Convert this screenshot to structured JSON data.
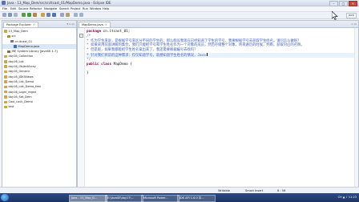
{
  "window": {
    "title": "Java - 13_Map_Dem/src/cn/itcast_01/MapDemo.java - Eclipse IDE",
    "min": "–",
    "max": "□",
    "close": "✕"
  },
  "menu": [
    "File",
    "Edit",
    "Source",
    "Refactor",
    "Navigate",
    "Search",
    "Project",
    "Run",
    "Window",
    "Help"
  ],
  "perspective": "Java",
  "package_explorer": {
    "tab_label": "Package Explorer",
    "tab_close": "✕",
    "items": [
      {
        "label": "13_Map_Dem",
        "icon": "project-icon",
        "indent": 0
      },
      {
        "label": "src",
        "icon": "source-folder-icon",
        "indent": 1
      },
      {
        "label": "cn.itcast_01",
        "icon": "package-icon",
        "indent": 2
      },
      {
        "label": "MapDemo.java",
        "icon": "java-file-icon",
        "indent": 3,
        "selected": true
      },
      {
        "label": "JRE System Library [JavaSE-1.7]",
        "icon": "library-icon",
        "indent": 1
      },
      {
        "label": "day16_Collection",
        "icon": "project-icon",
        "indent": 0
      },
      {
        "label": "day16_List",
        "icon": "project-icon",
        "indent": 0
      },
      {
        "label": "day16_ObjectArray",
        "icon": "project-icon",
        "indent": 0
      },
      {
        "label": "day16_Generic",
        "icon": "project-icon",
        "indent": 0
      },
      {
        "label": "day16_JDK5News",
        "icon": "project-icon",
        "indent": 0
      },
      {
        "label": "day16_List_Demo",
        "icon": "project-icon",
        "indent": 0
      },
      {
        "label": "day16_List_Demo_test",
        "icon": "project-icon",
        "indent": 0
      },
      {
        "label": "day16_Login_regist",
        "icon": "project-icon",
        "indent": 0
      },
      {
        "label": "day16_Set_Dem",
        "icon": "project-icon",
        "indent": 0
      },
      {
        "label": "Cool_Lock_Demo",
        "icon": "project-icon",
        "indent": 0
      },
      {
        "label": "test",
        "icon": "project-icon",
        "indent": 0
      }
    ]
  },
  "editor": {
    "tab_label": "MapDemo.java",
    "tab_close": "✕",
    "lines": [
      {
        "type": "code",
        "kw": "package",
        "rest": " cn.itcast_01;"
      },
      {
        "type": "comment",
        "text": "/*"
      },
      {
        "type": "comment",
        "text": " * 作为学生来说，是根据学号来区分不同的学生的，那么假设我现在已经知道了学生的学号，我要根据学号去获取学生姓名，请问怎么做呢？"
      },
      {
        "type": "comment",
        "text": " * 如果采用前面讲解的集合，我们只能把学号和学生姓名作为一个对象的成员，然后存储整个对象，将来遍历的时候，判断，获取对应的名称。"
      },
      {
        "type": "comment",
        "text": " * 但是呢，如果我都能把学生姓名拿出来了，我还需要根据编号去找吗？"
      },
      {
        "type": "comment",
        "text": " * 针对我们目前的这种需求：仅仅知道学号，就想知道学生姓名的情况，Java",
        "current": true
      },
      {
        "type": "comment",
        "text": " */"
      },
      {
        "type": "code",
        "kw": "public class",
        "rest": " MapDemo {"
      },
      {
        "type": "blank",
        "text": ""
      },
      {
        "type": "code",
        "kw": "",
        "rest": "}"
      }
    ]
  },
  "status": {
    "writable": "Writable",
    "insert": "Smart Insert",
    "position": "6 : 56"
  },
  "taskbar": {
    "tasks": [
      {
        "label": "Java - 13_Map_D...",
        "active": true
      },
      {
        "label": "E:\\JavaSE\\day17\\...",
        "active": false
      },
      {
        "label": "Microsoft Power...",
        "active": false
      },
      {
        "label": "JDK API 1.6.0 中...",
        "active": false
      }
    ],
    "tray": "CH ▲ ♪ 11:23"
  }
}
